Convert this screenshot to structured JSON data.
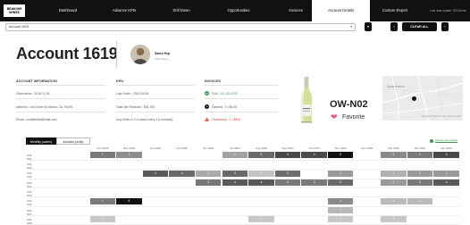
{
  "nav": {
    "logo": "BRAVIUM WINES",
    "tabs": [
      {
        "label": "Dashboard",
        "active": false
      },
      {
        "label": "Advance KPIs",
        "active": false
      },
      {
        "label": "Drill Down",
        "active": false
      },
      {
        "label": "Opportunities",
        "active": false
      },
      {
        "label": "Invoices",
        "active": false
      },
      {
        "label": "Account Details",
        "active": true
      },
      {
        "label": "Custom Report",
        "active": false
      }
    ],
    "last_date": "Last date update: 2020/xx/xx"
  },
  "toolbar": {
    "account_value": "Account 1619",
    "clear_all": "CLEAR ALL"
  },
  "account": {
    "title": "Account 1619",
    "rep_name": "Sales Rep",
    "rep_role": "Sales Rep 1"
  },
  "info": {
    "header": "ACCOUNT INFORMATION",
    "client_since": "Client since : 2016-11-26",
    "address": "Address : xxx Dome St,Venice, CA, 90291",
    "email": "Email : confidential@mail.com"
  },
  "kpis": {
    "header": "KPIs",
    "last_order": "Last Order : 2020-04-06",
    "total_net_revenue": "Total Net Revenue : $28,700",
    "avg_order": "Avg Order is 2.3 cases every 1.6 month(s)"
  },
  "invoices": {
    "header": "INVOICES",
    "paid": "Paid : 15 | $14,375",
    "opened": "Opened : 0 | $0.00",
    "overdue": "Overdue(s) : 1 | $510",
    "colors": {
      "paid": "#3a9b50",
      "opened": "#111111",
      "overdue": "#d33a3a"
    }
  },
  "wine": {
    "code": "OW-N02",
    "favorite_label": "Favorite"
  },
  "map": {
    "label": "Santa Monica",
    "attribution": "Map data ©2020 | 1 km | Terms of Use"
  },
  "bottom": {
    "tab_monthly": "Monthly (cases)",
    "tab_invoices": "Invoices (units)",
    "legend": "Account life details"
  },
  "grid": {
    "months": [
      "Nov 2019",
      "Dec 2019",
      "Jan 2020",
      "Feb 2020",
      "Jun 2020",
      "Jul 2020",
      "Aug 2020",
      "Sep 2020",
      "Oct 2020",
      "Nov 2020",
      "Dec 2020",
      "Feb 2020",
      "Mar 2020",
      "Apr 2020"
    ],
    "rows": [
      {
        "label": "OW-N01",
        "cells": [
          {
            "v": "1",
            "shade": "#7a7a7a"
          },
          {
            "v": "1",
            "shade": "#8e8e8e"
          },
          null,
          null,
          null,
          {
            "v": "2",
            "shade": "#a3a3a3"
          },
          {
            "v": "3",
            "shade": "#6a6a6a"
          },
          {
            "v": "4",
            "shade": "#4a4a4a"
          },
          {
            "v": "4",
            "shade": "#4a4a4a"
          },
          {
            "v": "8",
            "shade": "#111111"
          },
          null,
          {
            "v": "2",
            "shade": "#8a8a8a"
          },
          {
            "v": "1",
            "shade": "#7a7a7a"
          },
          {
            "v": "4",
            "shade": "#4a4a4a"
          }
        ]
      },
      {
        "label": "OW-N02",
        "cells": [
          null,
          null,
          null,
          null,
          null,
          null,
          null,
          null,
          null,
          null,
          null,
          null,
          null,
          null
        ]
      },
      {
        "label": "OW-N03",
        "cells": [
          null,
          null,
          {
            "v": "4",
            "shade": "#5a5a5a"
          },
          {
            "v": "4",
            "shade": "#6a6a6a"
          },
          {
            "v": "2",
            "shade": "#a9a9a9"
          },
          {
            "v": "3",
            "shade": "#6a6a6a"
          },
          {
            "v": "1",
            "shade": "#c4c4c4"
          },
          {
            "v": "2",
            "shade": "#6e6e6e"
          },
          null,
          {
            "v": "1",
            "shade": "#9a9a9a"
          },
          null,
          {
            "v": "1",
            "shade": "#b0b0b0"
          },
          {
            "v": "2",
            "shade": "#9a9a9a"
          },
          {
            "v": "1",
            "shade": "#9a9a9a"
          }
        ]
      },
      {
        "label": "OW-N04",
        "cells": [
          null,
          null,
          null,
          null,
          {
            "v": "3",
            "shade": "#767676"
          },
          {
            "v": "4",
            "shade": "#5a5a5a"
          },
          {
            "v": "4",
            "shade": "#5a5a5a"
          },
          {
            "v": "3",
            "shade": "#7a7a7a"
          },
          {
            "v": "3",
            "shade": "#7a7a7a"
          },
          {
            "v": "4",
            "shade": "#6a6a6a"
          },
          null,
          {
            "v": "2",
            "shade": "#9a9a9a"
          },
          {
            "v": "3",
            "shade": "#7a7a7a"
          },
          {
            "v": "4",
            "shade": "#5a5a5a"
          }
        ]
      },
      {
        "label": "OW-N05",
        "cells": [
          null,
          null,
          null,
          null,
          null,
          null,
          null,
          null,
          null,
          null,
          null,
          null,
          null,
          null
        ]
      },
      {
        "label": "OW-N06",
        "cells": [
          {
            "v": "1",
            "shade": "#7a7a7a"
          },
          {
            "v": "8",
            "shade": "#111111"
          },
          null,
          null,
          null,
          null,
          null,
          null,
          null,
          {
            "v": "1",
            "shade": "#8a8a8a"
          },
          null,
          {
            "v": "1",
            "shade": "#bbbbbb"
          },
          {
            "v": "1",
            "shade": "#bbbbbb"
          },
          null
        ]
      },
      {
        "label": "OW-N07",
        "cells": [
          null,
          null,
          null,
          null,
          null,
          null,
          null,
          null,
          null,
          {
            "v": "1",
            "shade": "#b8b8b8"
          },
          null,
          null,
          null,
          null
        ]
      },
      {
        "label": "OW-N08",
        "cells": [
          {
            "v": "1",
            "shade": "#c7c7c7"
          },
          null,
          null,
          null,
          null,
          null,
          {
            "v": "1",
            "shade": "#c7c7c7"
          },
          null,
          null,
          {
            "v": "1",
            "shade": "#c7c7c7"
          },
          null,
          {
            "v": "1",
            "shade": "#c7c7c7"
          },
          null,
          null
        ]
      }
    ]
  }
}
